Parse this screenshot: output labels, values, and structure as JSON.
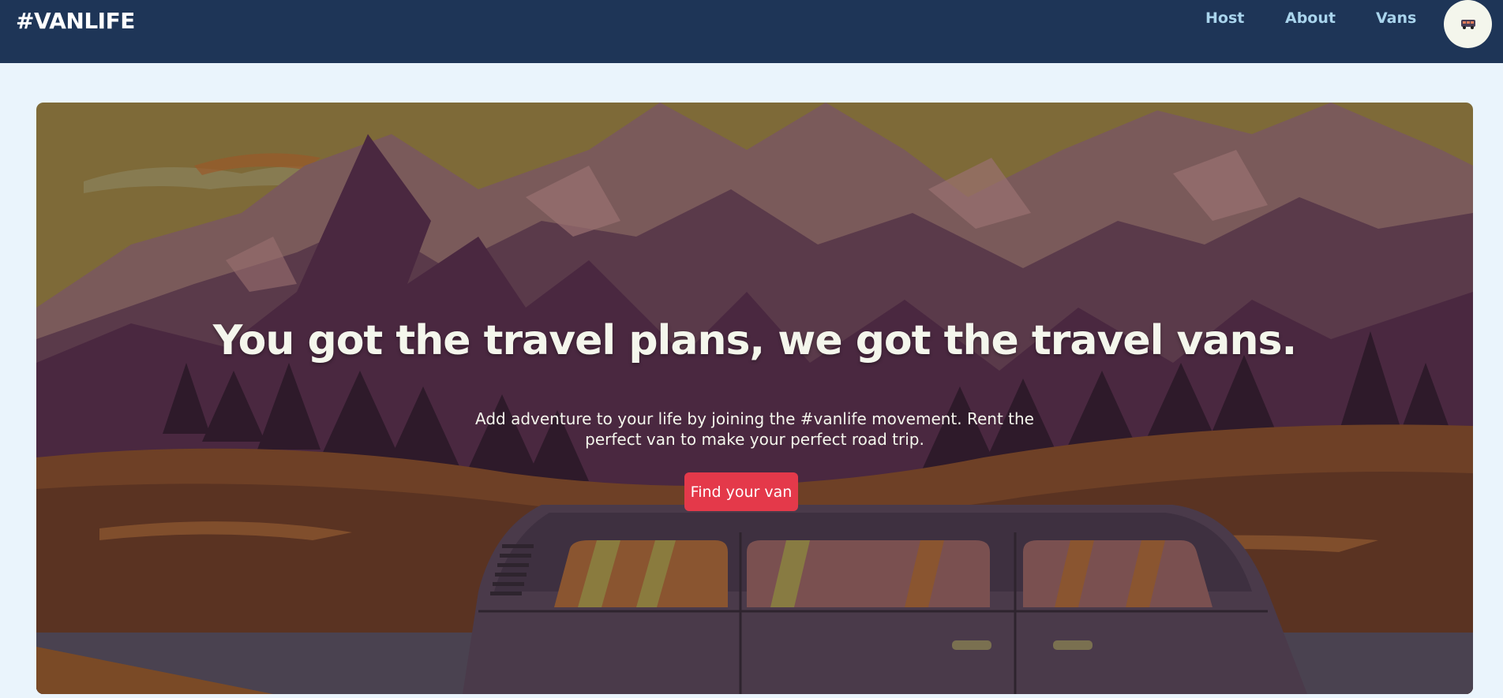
{
  "nav": {
    "logo": "#VANLIFE",
    "links": [
      {
        "label": "Host"
      },
      {
        "label": "About"
      },
      {
        "label": "Vans"
      }
    ],
    "avatar_icon": "van-avatar-icon"
  },
  "hero": {
    "title": "You got the travel plans, we got the travel vans.",
    "subtitle": "Add adventure to your life by joining the #vanlife movement. Rent the perfect van to make your perfect road trip.",
    "cta_label": "Find your van"
  },
  "colors": {
    "navbar_bg": "#1e3557",
    "page_bg": "#eaf4fc",
    "nav_link": "#a9d4ec",
    "cta_bg": "#e4394a",
    "hero_text": "#f4f6ec"
  }
}
